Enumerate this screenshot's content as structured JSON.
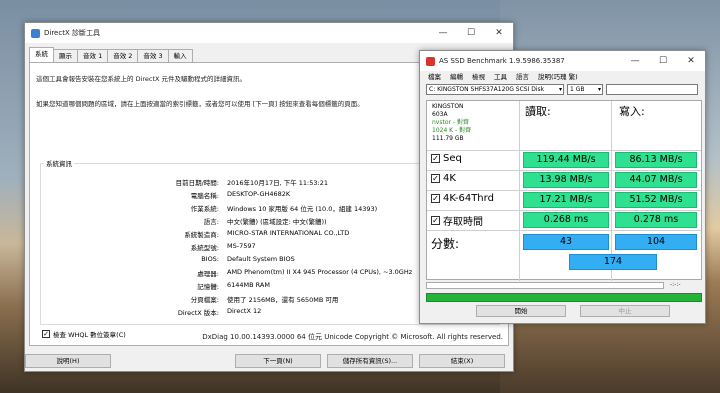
{
  "dxdiag": {
    "title": "DirectX 診斷工具",
    "tabs": [
      "系統",
      "顯示",
      "音效 1",
      "音效 2",
      "音效 3",
      "輸入"
    ],
    "intro_line1": "這個工具會報告安裝在您系統上的 DirectX 元件及驅動程式的詳細資訊。",
    "intro_line2": "如果您知道哪個問題的區域，請在上面按適當的索引標籤，或者您可以使用 [下一頁] 按鈕來查看每個標籤的頁面。",
    "group_title": "系統資訊",
    "info": [
      {
        "key": "目前日期/時間:",
        "value": "2016年10月17日, 下午 11:53:21"
      },
      {
        "key": "電腦名稱:",
        "value": "DESKTOP-GH4682K"
      },
      {
        "key": "作業系統:",
        "value": "Windows 10 家用版 64 位元 (10.0，組建 14393)"
      },
      {
        "key": "語言:",
        "value": "中文(繁體) (區域設定: 中文(繁體))"
      },
      {
        "key": "系統製造商:",
        "value": "MICRO-STAR INTERNATIONAL CO.,LTD"
      },
      {
        "key": "系統型號:",
        "value": "MS-7597"
      },
      {
        "key": "BIOS:",
        "value": "Default System BIOS"
      },
      {
        "key": "處理器:",
        "value": "AMD Phenom(tm) II X4 945 Processor (4 CPUs), ~3.0GHz"
      },
      {
        "key": "記憶體:",
        "value": "6144MB RAM"
      },
      {
        "key": "分頁檔案:",
        "value": "使用了 2156MB，還有 5650MB 可用"
      },
      {
        "key": "DirectX 版本:",
        "value": "DirectX 12"
      }
    ],
    "whql_label": "檢查 WHQL 數位簽章(C)",
    "version_line": "DxDiag 10.00.14393.0000 64 位元 Unicode  Copyright © Microsoft. All rights reserved.",
    "buttons": {
      "help": "說明(H)",
      "next": "下一頁(N)",
      "save": "儲存所有資訊(S)...",
      "exit": "結束(X)"
    }
  },
  "asssd": {
    "title": "AS SSD Benchmark 1.9.5986.35387",
    "menu": [
      "檔案",
      "編輯",
      "檢視",
      "工具",
      "語言",
      "說明(巧瑰 繁)"
    ],
    "drive_select": "C: KINGSTON SHFS37A120G SCSI Disk",
    "size_select": "1 GB",
    "drive_info": [
      "KINGSTON",
      "603A",
      "nvstor - 對齊",
      "1024 K - 對齊",
      "111.79 GB"
    ],
    "col_read": "讀取:",
    "col_write": "寫入:",
    "rows": [
      {
        "label": "Seq",
        "read": "119.44 MB/s",
        "write": "86.13 MB/s"
      },
      {
        "label": "4K",
        "read": "13.98 MB/s",
        "write": "44.07 MB/s"
      },
      {
        "label": "4K-64Thrd",
        "read": "17.21 MB/s",
        "write": "51.52 MB/s"
      },
      {
        "label": "存取時間",
        "read": "0.268 ms",
        "write": "0.278 ms"
      }
    ],
    "score_label": "分數:",
    "score_read": "43",
    "score_write": "104",
    "score_total": "174",
    "timer": "-:-:-",
    "btn_start": "開始",
    "btn_abort": "中止"
  }
}
